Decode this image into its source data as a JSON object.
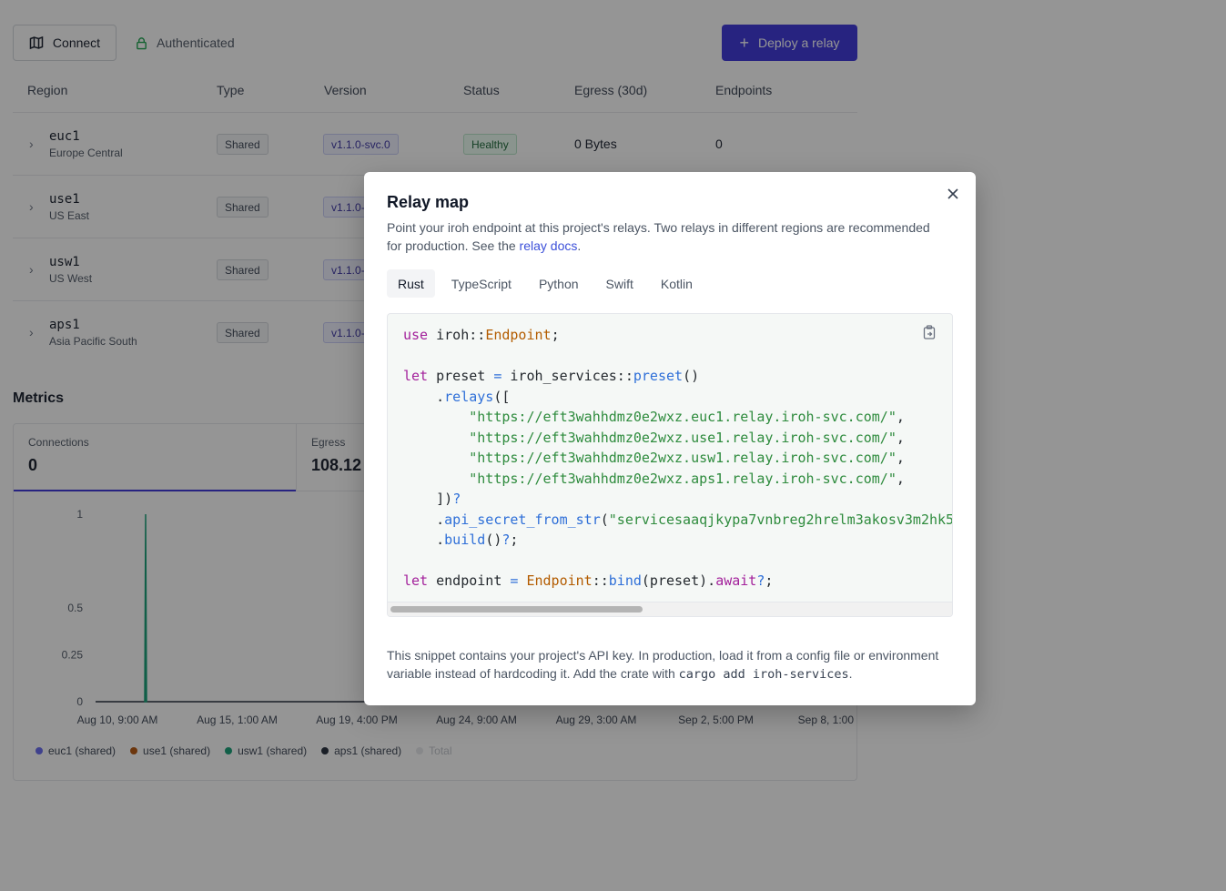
{
  "header": {
    "connect_label": "Connect",
    "auth_label": "Authenticated",
    "deploy_label": "Deploy a relay"
  },
  "table": {
    "columns": [
      "Region",
      "Type",
      "Version",
      "Status",
      "Egress (30d)",
      "Endpoints"
    ],
    "rows": [
      {
        "code": "euc1",
        "name": "Europe Central",
        "type": "Shared",
        "version": "v1.1.0-svc.0",
        "status": "Healthy",
        "egress": "0 Bytes",
        "endpoints": "0"
      },
      {
        "code": "use1",
        "name": "US East",
        "type": "Shared",
        "version": "v1.1.0-"
      },
      {
        "code": "usw1",
        "name": "US West",
        "type": "Shared",
        "version": "v1.1.0-"
      },
      {
        "code": "aps1",
        "name": "Asia Pacific South",
        "type": "Shared",
        "version": "v1.1.0-"
      }
    ]
  },
  "metrics": {
    "title": "Metrics",
    "tabs": [
      {
        "label": "Connections",
        "value": "0"
      },
      {
        "label": "Egress",
        "value": "108.12"
      }
    ]
  },
  "chart_data": {
    "type": "line",
    "yticks": [
      "1",
      "0.5",
      "0.25",
      "0"
    ],
    "xticks": [
      "Aug 10, 9:00 AM",
      "Aug 15, 1:00 AM",
      "Aug 19, 4:00 PM",
      "Aug 24, 9:00 AM",
      "Aug 29, 3:00 AM",
      "Sep 2, 5:00 PM",
      "Sep 8, 1:00 PM"
    ],
    "ylim": [
      0,
      1
    ],
    "series": [
      {
        "name": "euc1 (shared)",
        "color": "#6366f1",
        "values": []
      },
      {
        "name": "use1 (shared)",
        "color": "#b45309",
        "values": []
      },
      {
        "name": "usw1 (shared)",
        "color": "#0f9d74",
        "peak": {
          "x": "Aug 11",
          "y": 1
        }
      },
      {
        "name": "aps1 (shared)",
        "color": "#1f2937",
        "values": []
      },
      {
        "name": "Total",
        "color": "#d1d5db",
        "values": []
      }
    ]
  },
  "modal": {
    "title": "Relay map",
    "desc_before": "Point your iroh endpoint at this project's relays. Two relays in different regions are recommended for production. See the ",
    "desc_link": "relay docs",
    "desc_after": ".",
    "tabs": [
      "Rust",
      "TypeScript",
      "Python",
      "Swift",
      "Kotlin"
    ],
    "active_tab": "Rust",
    "relay_urls": [
      "\"https://eft3wahhdmz0e2wxz.euc1.relay.iroh-svc.com/\"",
      "\"https://eft3wahhdmz0e2wxz.use1.relay.iroh-svc.com/\"",
      "\"https://eft3wahhdmz0e2wxz.usw1.relay.iroh-svc.com/\"",
      "\"https://eft3wahhdmz0e2wxz.aps1.relay.iroh-svc.com/\""
    ],
    "api_secret": "\"servicesaaqjkypa7vnbreg2hrelm3akosv3m2hk5",
    "note_before": "This snippet contains your project's API key. In production, load it from a config file or environment variable instead of hardcoding it. Add the crate with ",
    "note_code": "cargo add iroh-services",
    "note_after": "."
  }
}
